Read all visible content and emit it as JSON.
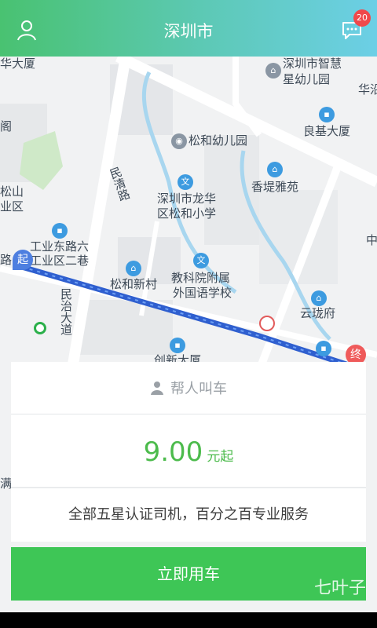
{
  "header": {
    "title": "深圳市",
    "message_count": "20"
  },
  "map": {
    "labels": [
      "华大厦",
      "深圳市智慧",
      "星幼儿园",
      "华沿",
      "良基大厦",
      "松和幼儿园",
      "阁",
      "民清路",
      "深圳市龙华",
      "区松和小学",
      "香堤雅苑",
      "松山",
      "业区",
      "工业东路六",
      "工业区二巷",
      "松和新村",
      "教科院附属",
      "外国语学校",
      "云珑府",
      "民治大道",
      "创新大厦",
      "中",
      "满"
    ],
    "start_marker": "起",
    "end_marker": "终",
    "road_label_left": "路"
  },
  "help_call": {
    "label": "帮人叫车"
  },
  "price": {
    "value": "9.00",
    "unit": "元起"
  },
  "slogan": "全部五星认证司机，百分之百专业服务",
  "cta": {
    "label": "立即用车"
  },
  "watermark": "七叶子"
}
